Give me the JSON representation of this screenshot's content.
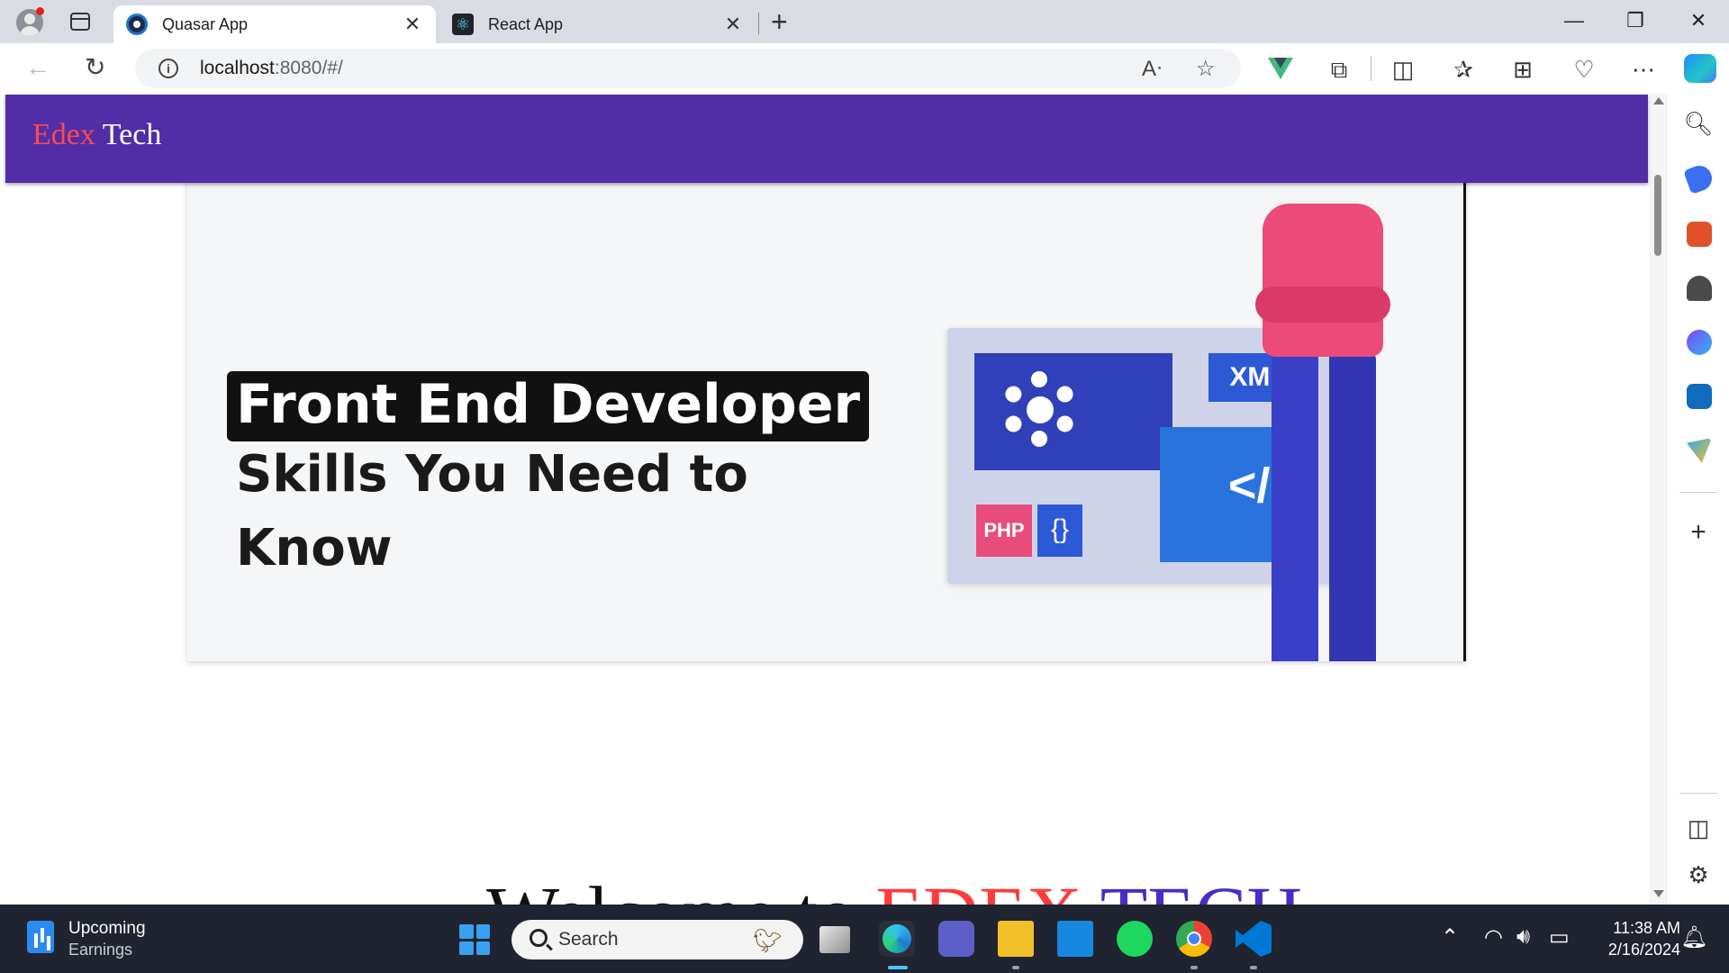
{
  "browser": {
    "tabs": [
      {
        "title": "Quasar App",
        "active": true
      },
      {
        "title": "React App",
        "active": false
      }
    ],
    "close_glyph": "✕",
    "new_tab_glyph": "+",
    "url_host": "localhost",
    "url_rest": ":8080/#/",
    "window_controls": {
      "minimize": "—",
      "restore": "❐",
      "close": "✕"
    }
  },
  "page": {
    "brand_first": "Edex",
    "brand_second": "Tech",
    "banner": {
      "highlight": "Front End Developer",
      "line2": "Skills You Need to",
      "line3": "Know",
      "tag_xml": "XML",
      "tag_code": "</>",
      "tag_php": "PHP",
      "tag_braces": "{}"
    },
    "welcome": {
      "part1": "Welcome to ",
      "part2": "EDEX ",
      "part3": "TECH"
    }
  },
  "taskbar": {
    "widget_title": "Upcoming",
    "widget_subtitle": "Earnings",
    "search_placeholder": "Search",
    "time": "11:38 AM",
    "date": "2/16/2024"
  },
  "colors": {
    "header": "#512da8",
    "brand_accent": "#ff4a4a",
    "taskbar": "#1f2430"
  }
}
